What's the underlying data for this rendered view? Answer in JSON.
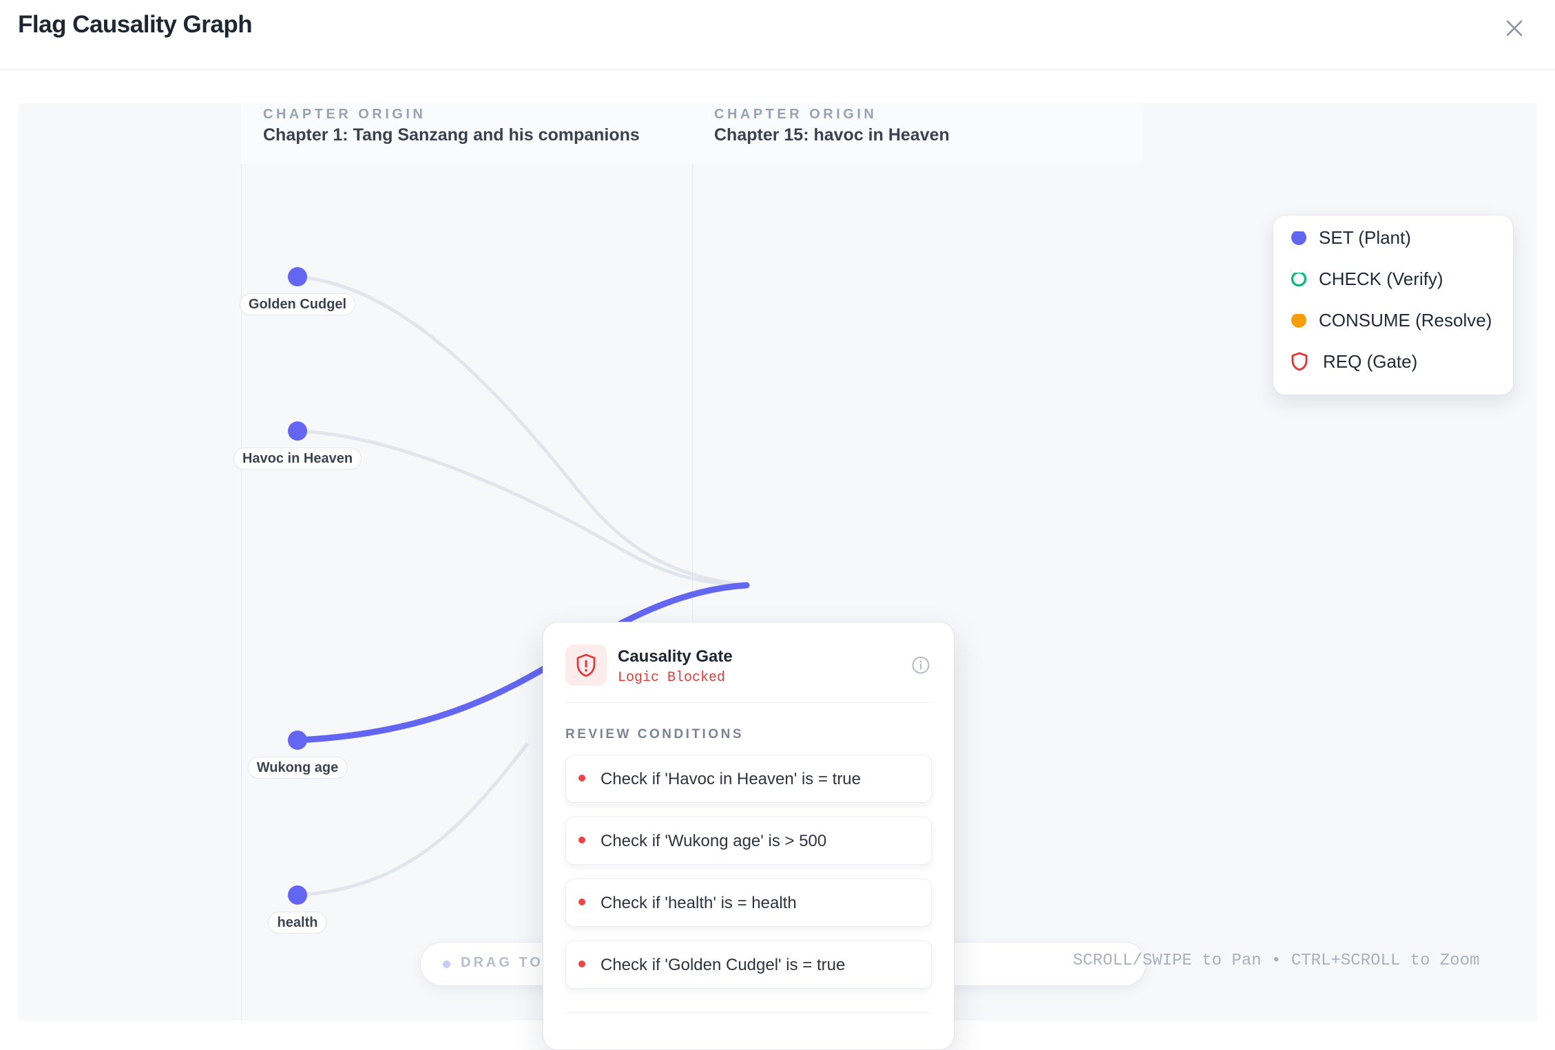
{
  "header": {
    "title": "Flag Causality Graph"
  },
  "lanes": [
    {
      "kicker": "CHAPTER ORIGIN",
      "title": "Chapter 1: Tang Sanzang and his companions"
    },
    {
      "kicker": "CHAPTER ORIGIN",
      "title": "Chapter 15: havoc in Heaven"
    }
  ],
  "nodes": [
    {
      "label": "Golden Cudgel"
    },
    {
      "label": "Havoc in Heaven"
    },
    {
      "label": "Wukong age"
    },
    {
      "label": "health"
    }
  ],
  "legend": [
    {
      "icon": "set-dot",
      "label": "SET (Plant)",
      "color": "#6366f1"
    },
    {
      "icon": "check-ring",
      "label": "CHECK (Verify)",
      "color": "#10b981"
    },
    {
      "icon": "consume-dot",
      "label": "CONSUME (Resolve)",
      "color": "#f59e0b"
    },
    {
      "icon": "shield-icon",
      "label": "REQ (Gate)",
      "color": "#e03a3a"
    }
  ],
  "hints": {
    "drag": "DRAG TO PAN • TRACE DEPENDENCIES",
    "pan_zoom": "SCROLL/SWIPE to Pan • CTRL+SCROLL to Zoom"
  },
  "gate_panel": {
    "title": "Causality Gate",
    "status": "Logic Blocked",
    "conditions_heading": "REVIEW CONDITIONS",
    "conditions": [
      "Check if 'Havoc in Heaven' is = true",
      "Check if 'Wukong age' is > 500",
      "Check if 'health' is = health",
      "Check if 'Golden Cudgel' is = true"
    ]
  },
  "colors": {
    "set": "#6366f1",
    "gate": "#e03a3a",
    "edge": "#e2e6ec"
  }
}
